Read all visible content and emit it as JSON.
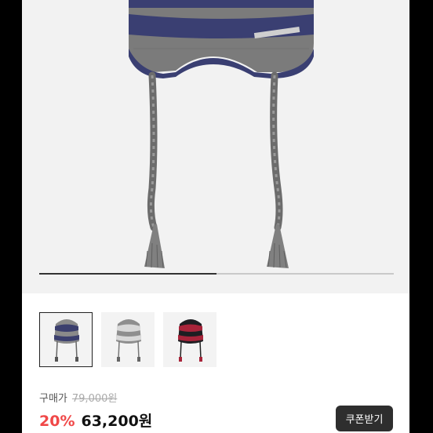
{
  "product": {
    "gallery": {
      "progress": 0.5
    },
    "thumbnails": [
      {
        "label": "navy-gray stripe",
        "colors": {
          "base": "#8a8a8a",
          "stripe": "#3b3f6e"
        }
      },
      {
        "label": "gray-light stripe",
        "colors": {
          "base": "#8e8e8e",
          "stripe": "#d8d8d8"
        }
      },
      {
        "label": "red-black stripe",
        "colors": {
          "base": "#1e1e22",
          "stripe": "#a8243a"
        }
      }
    ],
    "price": {
      "buy_label": "구매가",
      "original": "79,000원",
      "discount": "20%",
      "sale": "63,200원"
    },
    "coupon_button": "쿠폰받기"
  },
  "colors": {
    "hero_bg": "#f2f2f2",
    "hat_gray": "#7b7b7b",
    "hat_navy": "#3a3f72",
    "discount_red": "#f04848",
    "button_dark": "#2e2e2e"
  }
}
